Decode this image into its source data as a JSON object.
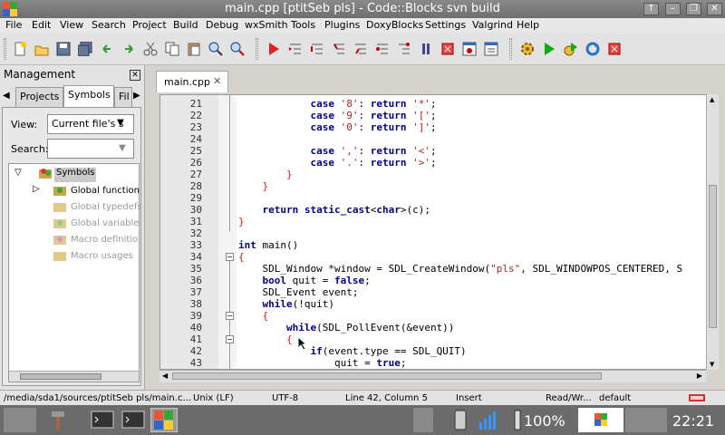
{
  "window": {
    "title": "main.cpp [ptitSeb pls] - Code::Blocks svn build"
  },
  "menu": [
    "File",
    "Edit",
    "View",
    "Search",
    "Project",
    "Build",
    "Debug",
    "wxSmith",
    "Tools",
    "Plugins",
    "DoxyBlocks",
    "Settings",
    "Valgrind",
    "Help"
  ],
  "management": {
    "title": "Management",
    "tabs": [
      "Projects",
      "Symbols",
      "Fil"
    ],
    "view_label": "View:",
    "view_value": "Current file's s",
    "search_label": "Search:",
    "search_value": ""
  },
  "tree": {
    "root": "Symbols",
    "items": [
      "Global function",
      "Global typedefs",
      "Global variable",
      "Macro definitio",
      "Macro usages"
    ]
  },
  "editor": {
    "tab": "main.cpp",
    "lines": [
      {
        "n": "21",
        "t": "            case '8': return '*';"
      },
      {
        "n": "22",
        "t": "            case '9': return '[';"
      },
      {
        "n": "23",
        "t": "            case '0': return ']';"
      },
      {
        "n": "24",
        "t": ""
      },
      {
        "n": "25",
        "t": "            case ',': return '<';"
      },
      {
        "n": "26",
        "t": "            case '.': return '>';"
      },
      {
        "n": "27",
        "t": "        }"
      },
      {
        "n": "28",
        "t": "    }"
      },
      {
        "n": "29",
        "t": ""
      },
      {
        "n": "30",
        "t": "    return static_cast<char>(c);"
      },
      {
        "n": "31",
        "t": "}"
      },
      {
        "n": "32",
        "t": ""
      },
      {
        "n": "33",
        "t": "int main()"
      },
      {
        "n": "34",
        "t": "{"
      },
      {
        "n": "35",
        "t": "    SDL_Window *window = SDL_CreateWindow(\"pls\", SDL_WINDOWPOS_CENTERED, S"
      },
      {
        "n": "36",
        "t": "    bool quit = false;"
      },
      {
        "n": "37",
        "t": "    SDL_Event event;"
      },
      {
        "n": "38",
        "t": "    while(!quit)"
      },
      {
        "n": "39",
        "t": "    {"
      },
      {
        "n": "40",
        "t": "        while(SDL_PollEvent(&event))"
      },
      {
        "n": "41",
        "t": "        {"
      },
      {
        "n": "42",
        "t": "            if(event.type == SDL_QUIT)"
      },
      {
        "n": "43",
        "t": "                quit = true;"
      }
    ]
  },
  "status": {
    "path": "/media/sda1/sources/ptitSeb pls/main.c...",
    "eol": "Unix (LF)",
    "enc": "UTF-8",
    "pos": "Line 42, Column 5",
    "mode": "Insert",
    "rw": "Read/Wr...",
    "prof": "default"
  },
  "taskbar": {
    "battery": "100%",
    "clock": "22:21"
  }
}
